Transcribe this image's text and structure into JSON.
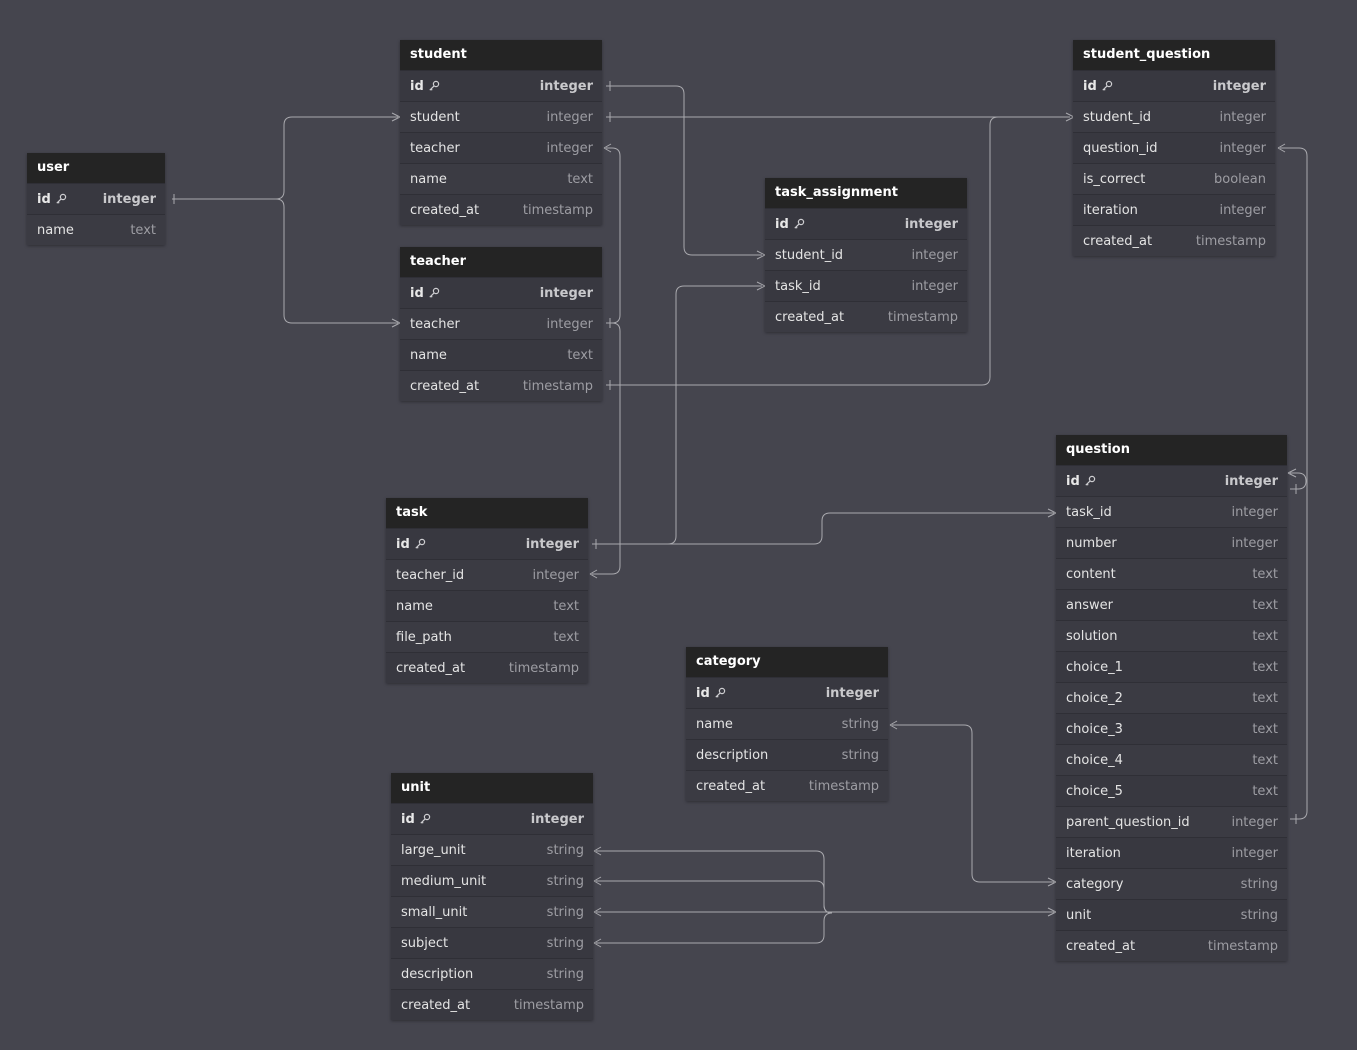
{
  "tables": {
    "user": {
      "title": "user",
      "fields": [
        {
          "name": "id",
          "type": "integer",
          "pk": true
        },
        {
          "name": "name",
          "type": "text"
        }
      ]
    },
    "student": {
      "title": "student",
      "fields": [
        {
          "name": "id",
          "type": "integer",
          "pk": true
        },
        {
          "name": "student",
          "type": "integer"
        },
        {
          "name": "teacher",
          "type": "integer"
        },
        {
          "name": "name",
          "type": "text"
        },
        {
          "name": "created_at",
          "type": "timestamp"
        }
      ]
    },
    "teacher": {
      "title": "teacher",
      "fields": [
        {
          "name": "id",
          "type": "integer",
          "pk": true
        },
        {
          "name": "teacher",
          "type": "integer"
        },
        {
          "name": "name",
          "type": "text"
        },
        {
          "name": "created_at",
          "type": "timestamp"
        }
      ]
    },
    "task": {
      "title": "task",
      "fields": [
        {
          "name": "id",
          "type": "integer",
          "pk": true
        },
        {
          "name": "teacher_id",
          "type": "integer"
        },
        {
          "name": "name",
          "type": "text"
        },
        {
          "name": "file_path",
          "type": "text"
        },
        {
          "name": "created_at",
          "type": "timestamp"
        }
      ]
    },
    "unit": {
      "title": "unit",
      "fields": [
        {
          "name": "id",
          "type": "integer",
          "pk": true
        },
        {
          "name": "large_unit",
          "type": "string"
        },
        {
          "name": "medium_unit",
          "type": "string"
        },
        {
          "name": "small_unit",
          "type": "string"
        },
        {
          "name": "subject",
          "type": "string"
        },
        {
          "name": "description",
          "type": "string"
        },
        {
          "name": "created_at",
          "type": "timestamp"
        }
      ]
    },
    "task_assignment": {
      "title": "task_assignment",
      "fields": [
        {
          "name": "id",
          "type": "integer",
          "pk": true
        },
        {
          "name": "student_id",
          "type": "integer"
        },
        {
          "name": "task_id",
          "type": "integer"
        },
        {
          "name": "created_at",
          "type": "timestamp"
        }
      ]
    },
    "category": {
      "title": "category",
      "fields": [
        {
          "name": "id",
          "type": "integer",
          "pk": true
        },
        {
          "name": "name",
          "type": "string"
        },
        {
          "name": "description",
          "type": "string"
        },
        {
          "name": "created_at",
          "type": "timestamp"
        }
      ]
    },
    "student_question": {
      "title": "student_question",
      "fields": [
        {
          "name": "id",
          "type": "integer",
          "pk": true
        },
        {
          "name": "student_id",
          "type": "integer"
        },
        {
          "name": "question_id",
          "type": "integer"
        },
        {
          "name": "is_correct",
          "type": "boolean"
        },
        {
          "name": "iteration",
          "type": "integer"
        },
        {
          "name": "created_at",
          "type": "timestamp"
        }
      ]
    },
    "question": {
      "title": "question",
      "fields": [
        {
          "name": "id",
          "type": "integer",
          "pk": true
        },
        {
          "name": "task_id",
          "type": "integer"
        },
        {
          "name": "number",
          "type": "integer"
        },
        {
          "name": "content",
          "type": "text"
        },
        {
          "name": "answer",
          "type": "text"
        },
        {
          "name": "solution",
          "type": "text"
        },
        {
          "name": "choice_1",
          "type": "text"
        },
        {
          "name": "choice_2",
          "type": "text"
        },
        {
          "name": "choice_3",
          "type": "text"
        },
        {
          "name": "choice_4",
          "type": "text"
        },
        {
          "name": "choice_5",
          "type": "text"
        },
        {
          "name": "parent_question_id",
          "type": "integer"
        },
        {
          "name": "iteration",
          "type": "integer"
        },
        {
          "name": "category",
          "type": "string"
        },
        {
          "name": "unit",
          "type": "string"
        },
        {
          "name": "created_at",
          "type": "timestamp"
        }
      ]
    }
  },
  "colors": {
    "background": "#45454e",
    "table_header": "#242424",
    "table_body": "#383840",
    "edge": "#a9a9ae"
  }
}
